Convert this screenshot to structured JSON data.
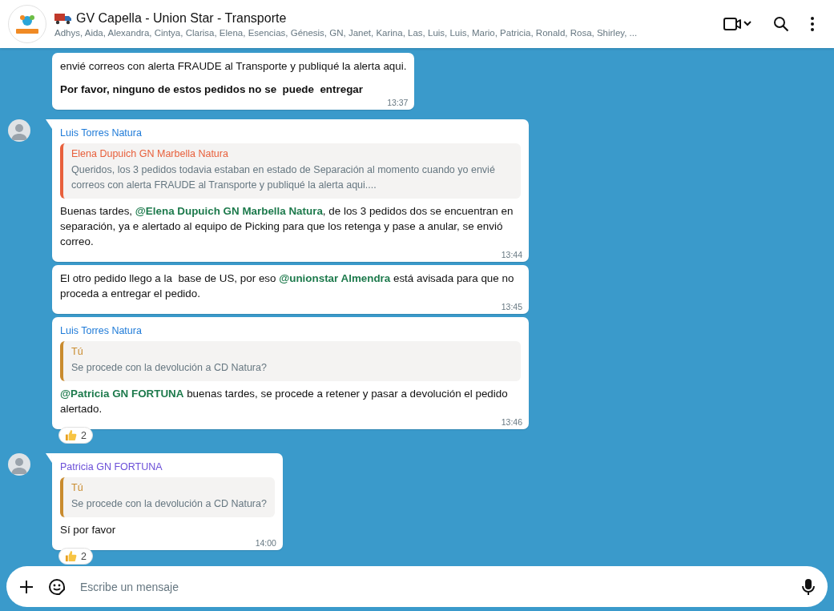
{
  "header": {
    "title": "GV Capella - Union Star - Transporte",
    "members": "Adhys, Aida, Alexandra, Cintya, Clarisa, Elena, Esencias, Génesis, GN, Janet, Karina, Las, Luis, Luis, Mario, Patricia, Ronald, Rosa, Shirley, ..."
  },
  "messages": [
    {
      "first_in_group": false,
      "paragraphs": [
        [
          {
            "kind": "plain",
            "text": "envié correos con alerta FRAUDE al Transporte y publiqué la alerta aqui."
          }
        ],
        [
          {
            "kind": "bold",
            "text": "Por favor, ninguno de estos pedidos no se  puede  entregar"
          }
        ]
      ],
      "time": "13:37"
    },
    {
      "first_in_group": true,
      "sender": "Luis Torres Natura",
      "color": "#1f7bd8",
      "quote": {
        "author": "Elena Dupuich GN Marbella Natura",
        "color": "#e8603c",
        "text": "Queridos, los 3 pedidos todavia  estaban en estado de  Separación al momento cuando yo envié correos con alerta FRAUDE al Transporte y publiqué la alerta aqui...."
      },
      "paragraphs": [
        [
          {
            "kind": "plain",
            "text": "Buenas tardes, "
          },
          {
            "kind": "mention",
            "text": "@Elena Dupuich GN Marbella Natura"
          },
          {
            "kind": "plain",
            "text": ", de los 3 pedidos dos se encuentran en separación, ya e alertado al equipo de Picking para que los retenga y pase a anular, se envió correo."
          }
        ]
      ],
      "time": "13:44"
    },
    {
      "first_in_group": false,
      "paragraphs": [
        [
          {
            "kind": "plain",
            "text": "El otro pedido llego a la  base de US, por eso "
          },
          {
            "kind": "mention",
            "text": "@unionstar Almendra"
          },
          {
            "kind": "plain",
            "text": " está avisada para que no proceda a entregar el pedido."
          }
        ]
      ],
      "time": "13:45"
    },
    {
      "first_in_group": false,
      "sender": "Luis Torres Natura",
      "color": "#1f7bd8",
      "quote": {
        "author": "Tú",
        "color": "#c98b2e",
        "text": "Se procede con la devolución a CD Natura?"
      },
      "paragraphs": [
        [
          {
            "kind": "mention",
            "text": "@Patricia GN FORTUNA"
          },
          {
            "kind": "plain",
            "text": " buenas tardes, se procede a retener y pasar a devolución el pedido alertado."
          }
        ]
      ],
      "time": "13:46",
      "reaction": {
        "count": "2"
      }
    },
    {
      "first_in_group": true,
      "sender": "Patricia GN FORTUNA",
      "color": "#6b4fd8",
      "quote": {
        "author": "Tú",
        "color": "#c98b2e",
        "text": "Se procede con la devolución a CD Natura?"
      },
      "paragraphs": [
        [
          {
            "kind": "plain",
            "text": "Sí por favor"
          }
        ]
      ],
      "time": "14:00",
      "reaction": {
        "count": "2"
      }
    }
  ],
  "composer": {
    "placeholder": "Escribe un mensaje"
  }
}
